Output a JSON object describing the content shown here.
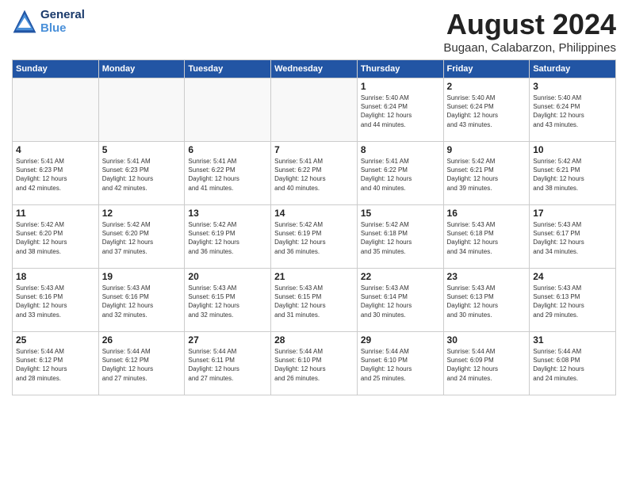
{
  "header": {
    "logo_line1": "General",
    "logo_line2": "Blue",
    "month_year": "August 2024",
    "location": "Bugaan, Calabarzon, Philippines"
  },
  "weekdays": [
    "Sunday",
    "Monday",
    "Tuesday",
    "Wednesday",
    "Thursday",
    "Friday",
    "Saturday"
  ],
  "weeks": [
    [
      {
        "day": "",
        "info": ""
      },
      {
        "day": "",
        "info": ""
      },
      {
        "day": "",
        "info": ""
      },
      {
        "day": "",
        "info": ""
      },
      {
        "day": "1",
        "info": "Sunrise: 5:40 AM\nSunset: 6:24 PM\nDaylight: 12 hours\nand 44 minutes."
      },
      {
        "day": "2",
        "info": "Sunrise: 5:40 AM\nSunset: 6:24 PM\nDaylight: 12 hours\nand 43 minutes."
      },
      {
        "day": "3",
        "info": "Sunrise: 5:40 AM\nSunset: 6:24 PM\nDaylight: 12 hours\nand 43 minutes."
      }
    ],
    [
      {
        "day": "4",
        "info": "Sunrise: 5:41 AM\nSunset: 6:23 PM\nDaylight: 12 hours\nand 42 minutes."
      },
      {
        "day": "5",
        "info": "Sunrise: 5:41 AM\nSunset: 6:23 PM\nDaylight: 12 hours\nand 42 minutes."
      },
      {
        "day": "6",
        "info": "Sunrise: 5:41 AM\nSunset: 6:22 PM\nDaylight: 12 hours\nand 41 minutes."
      },
      {
        "day": "7",
        "info": "Sunrise: 5:41 AM\nSunset: 6:22 PM\nDaylight: 12 hours\nand 40 minutes."
      },
      {
        "day": "8",
        "info": "Sunrise: 5:41 AM\nSunset: 6:22 PM\nDaylight: 12 hours\nand 40 minutes."
      },
      {
        "day": "9",
        "info": "Sunrise: 5:42 AM\nSunset: 6:21 PM\nDaylight: 12 hours\nand 39 minutes."
      },
      {
        "day": "10",
        "info": "Sunrise: 5:42 AM\nSunset: 6:21 PM\nDaylight: 12 hours\nand 38 minutes."
      }
    ],
    [
      {
        "day": "11",
        "info": "Sunrise: 5:42 AM\nSunset: 6:20 PM\nDaylight: 12 hours\nand 38 minutes."
      },
      {
        "day": "12",
        "info": "Sunrise: 5:42 AM\nSunset: 6:20 PM\nDaylight: 12 hours\nand 37 minutes."
      },
      {
        "day": "13",
        "info": "Sunrise: 5:42 AM\nSunset: 6:19 PM\nDaylight: 12 hours\nand 36 minutes."
      },
      {
        "day": "14",
        "info": "Sunrise: 5:42 AM\nSunset: 6:19 PM\nDaylight: 12 hours\nand 36 minutes."
      },
      {
        "day": "15",
        "info": "Sunrise: 5:42 AM\nSunset: 6:18 PM\nDaylight: 12 hours\nand 35 minutes."
      },
      {
        "day": "16",
        "info": "Sunrise: 5:43 AM\nSunset: 6:18 PM\nDaylight: 12 hours\nand 34 minutes."
      },
      {
        "day": "17",
        "info": "Sunrise: 5:43 AM\nSunset: 6:17 PM\nDaylight: 12 hours\nand 34 minutes."
      }
    ],
    [
      {
        "day": "18",
        "info": "Sunrise: 5:43 AM\nSunset: 6:16 PM\nDaylight: 12 hours\nand 33 minutes."
      },
      {
        "day": "19",
        "info": "Sunrise: 5:43 AM\nSunset: 6:16 PM\nDaylight: 12 hours\nand 32 minutes."
      },
      {
        "day": "20",
        "info": "Sunrise: 5:43 AM\nSunset: 6:15 PM\nDaylight: 12 hours\nand 32 minutes."
      },
      {
        "day": "21",
        "info": "Sunrise: 5:43 AM\nSunset: 6:15 PM\nDaylight: 12 hours\nand 31 minutes."
      },
      {
        "day": "22",
        "info": "Sunrise: 5:43 AM\nSunset: 6:14 PM\nDaylight: 12 hours\nand 30 minutes."
      },
      {
        "day": "23",
        "info": "Sunrise: 5:43 AM\nSunset: 6:13 PM\nDaylight: 12 hours\nand 30 minutes."
      },
      {
        "day": "24",
        "info": "Sunrise: 5:43 AM\nSunset: 6:13 PM\nDaylight: 12 hours\nand 29 minutes."
      }
    ],
    [
      {
        "day": "25",
        "info": "Sunrise: 5:44 AM\nSunset: 6:12 PM\nDaylight: 12 hours\nand 28 minutes."
      },
      {
        "day": "26",
        "info": "Sunrise: 5:44 AM\nSunset: 6:12 PM\nDaylight: 12 hours\nand 27 minutes."
      },
      {
        "day": "27",
        "info": "Sunrise: 5:44 AM\nSunset: 6:11 PM\nDaylight: 12 hours\nand 27 minutes."
      },
      {
        "day": "28",
        "info": "Sunrise: 5:44 AM\nSunset: 6:10 PM\nDaylight: 12 hours\nand 26 minutes."
      },
      {
        "day": "29",
        "info": "Sunrise: 5:44 AM\nSunset: 6:10 PM\nDaylight: 12 hours\nand 25 minutes."
      },
      {
        "day": "30",
        "info": "Sunrise: 5:44 AM\nSunset: 6:09 PM\nDaylight: 12 hours\nand 24 minutes."
      },
      {
        "day": "31",
        "info": "Sunrise: 5:44 AM\nSunset: 6:08 PM\nDaylight: 12 hours\nand 24 minutes."
      }
    ]
  ]
}
